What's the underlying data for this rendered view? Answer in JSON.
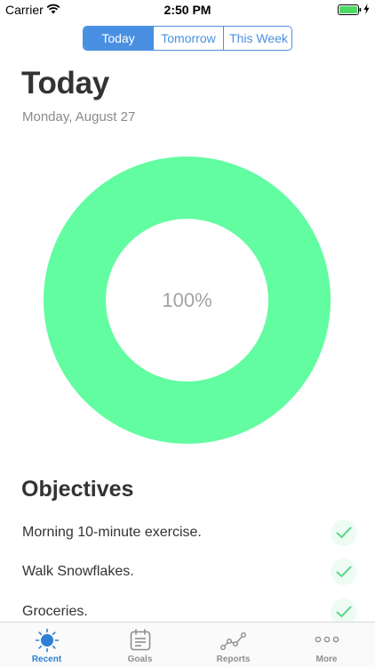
{
  "status_bar": {
    "carrier": "Carrier",
    "time": "2:50 PM"
  },
  "segments": [
    {
      "label": "Today",
      "active": true
    },
    {
      "label": "Tomorrow",
      "active": false
    },
    {
      "label": "This Week",
      "active": false
    }
  ],
  "header": {
    "title": "Today",
    "date": "Monday, August 27"
  },
  "progress": {
    "label": "100%",
    "value": 1.0,
    "color": "#62fca1"
  },
  "objectives": {
    "title": "Objectives",
    "items": [
      {
        "label": "Morning 10-minute exercise.",
        "done": true
      },
      {
        "label": "Walk Snowflakes.",
        "done": true
      },
      {
        "label": "Groceries.",
        "done": true
      }
    ]
  },
  "tabs": [
    {
      "label": "Recent",
      "icon": "sun-icon",
      "active": true
    },
    {
      "label": "Goals",
      "icon": "calendar-icon",
      "active": false
    },
    {
      "label": "Reports",
      "icon": "chart-icon",
      "active": false
    },
    {
      "label": "More",
      "icon": "more-icon",
      "active": false
    }
  ],
  "colors": {
    "accent": "#4a90e2",
    "ring": "#62fca1",
    "check": "#5fd68b",
    "battery": "#4cd964"
  }
}
